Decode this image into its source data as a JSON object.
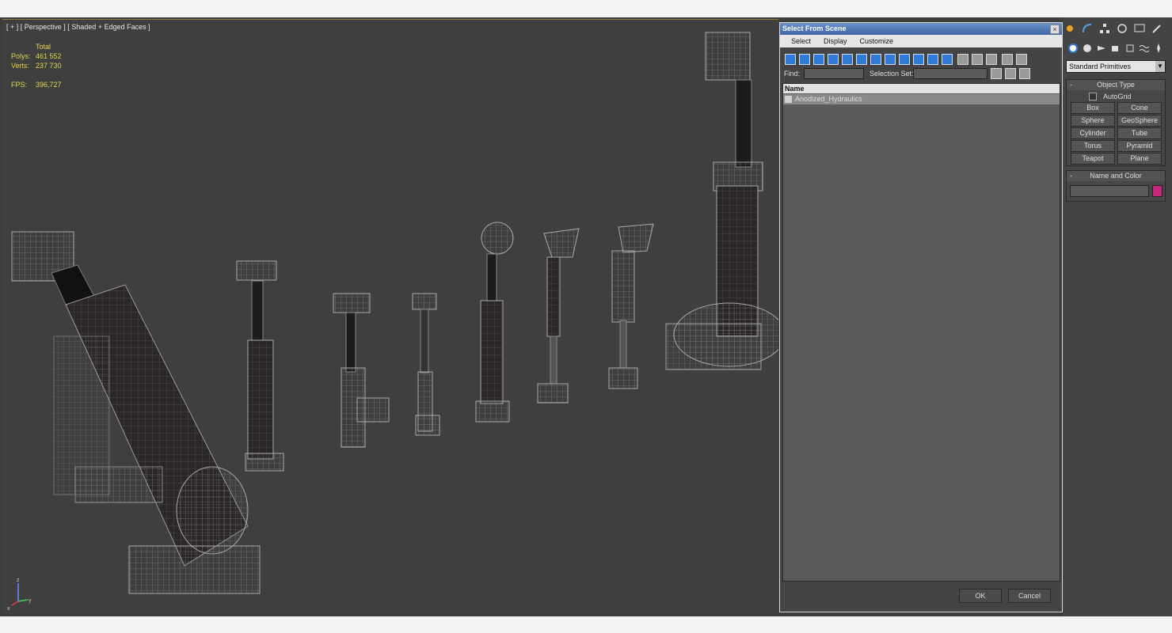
{
  "viewport": {
    "label": "[ + ] [ Perspective ] [ Shaded + Edged Faces ]",
    "stats": {
      "header": "Total",
      "polys_label": "Polys:",
      "polys_value": "461 552",
      "verts_label": "Verts:",
      "verts_value": "237 730",
      "fps_label": "FPS:",
      "fps_value": "396,727"
    },
    "axis": {
      "z": "z",
      "x": "x",
      "y": "y"
    }
  },
  "dialog": {
    "title": "Select From Scene",
    "close": "×",
    "menu": [
      "Select",
      "Display",
      "Customize"
    ],
    "find_label": "Find:",
    "find_value": "",
    "selection_set_label": "Selection Set:",
    "selection_set_value": "",
    "list_header": "Name",
    "items": [
      "Anodized_Hydraulics"
    ],
    "ok_label": "OK",
    "cancel_label": "Cancel"
  },
  "command_panel": {
    "dropdown": "Standard Primitives",
    "object_type": {
      "title": "Object Type",
      "autogrid": "AutoGrid",
      "buttons": [
        "Box",
        "Cone",
        "Sphere",
        "GeoSphere",
        "Cylinder",
        "Tube",
        "Torus",
        "Pyramid",
        "Teapot",
        "Plane"
      ]
    },
    "name_color": {
      "title": "Name and Color",
      "name_value": "",
      "swatch_color": "#c8287a"
    }
  },
  "colors": {
    "accent": "#2f7bd6",
    "stats": "#e2d74a",
    "viewport_bg": "#3f3f3f"
  }
}
